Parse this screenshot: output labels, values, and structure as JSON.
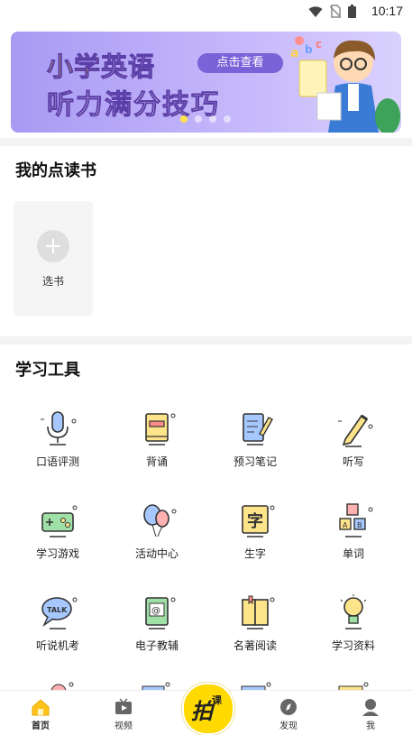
{
  "status_bar": {
    "time": "10:17"
  },
  "banner": {
    "title_part1": "小学",
    "title_part2": "英语",
    "button": "点击查看",
    "title_line2": "听力满分技巧",
    "dots": 4,
    "active_dot": 0
  },
  "my_books": {
    "title": "我的点读书",
    "add_label": "选书"
  },
  "tools": {
    "title": "学习工具",
    "items": [
      {
        "label": "口语评测",
        "icon": "microphone-icon"
      },
      {
        "label": "背诵",
        "icon": "book-icon"
      },
      {
        "label": "预习笔记",
        "icon": "notebook-pen-icon"
      },
      {
        "label": "听写",
        "icon": "pencil-icon"
      },
      {
        "label": "学习游戏",
        "icon": "gamepad-icon"
      },
      {
        "label": "活动中心",
        "icon": "balloons-icon"
      },
      {
        "label": "生字",
        "icon": "character-card-icon"
      },
      {
        "label": "单词",
        "icon": "letter-blocks-icon"
      },
      {
        "label": "听说机考",
        "icon": "talk-bubble-icon"
      },
      {
        "label": "电子教辅",
        "icon": "e-book-icon"
      },
      {
        "label": "名著阅读",
        "icon": "open-book-icon"
      },
      {
        "label": "学习资料",
        "icon": "lightbulb-icon"
      }
    ]
  },
  "tabbar": {
    "items": [
      {
        "label": "首页",
        "icon": "home-icon",
        "active": true
      },
      {
        "label": "视频",
        "icon": "video-icon",
        "active": false
      },
      {
        "label": "发现",
        "icon": "compass-icon",
        "active": false
      },
      {
        "label": "我",
        "icon": "profile-icon",
        "active": false
      }
    ],
    "center": {
      "label_main": "拍",
      "label_sub": "课",
      "color": "#ffd900"
    }
  },
  "colors": {
    "accent": "#ffd900",
    "banner_purple": "#a89af3",
    "icon_yellow": "#fde48a",
    "icon_dark": "#333333"
  }
}
